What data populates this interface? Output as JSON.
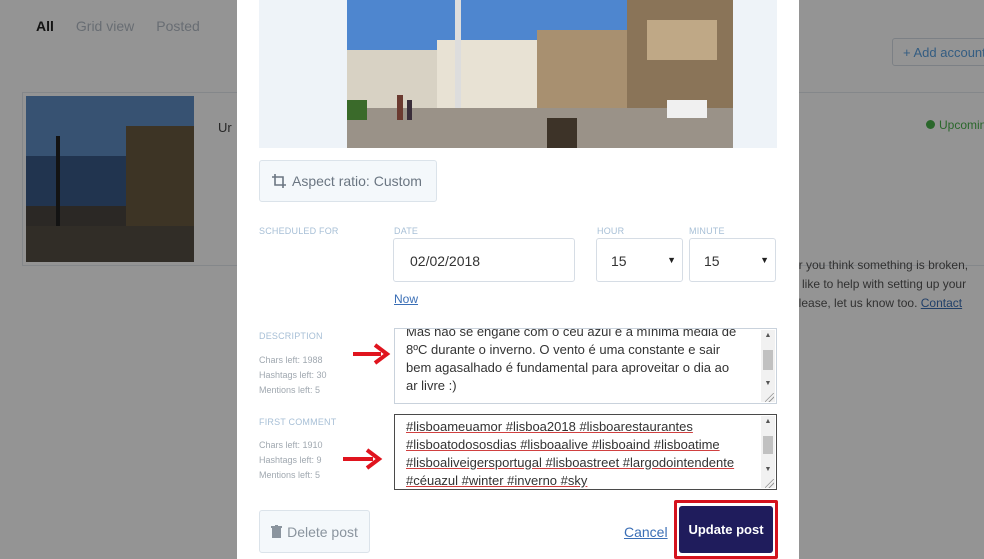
{
  "background": {
    "tabs": [
      "All",
      "Grid view",
      "Posted"
    ],
    "add_account": "+ Add account",
    "card_title": "Ur",
    "status": "Upcoming",
    "help_lines": [
      "or you think something is broken,",
      "d like to help with setting up your",
      "please, let us know too."
    ],
    "help_link": "Contact"
  },
  "modal": {
    "aspect_ratio": {
      "prefix": "Aspect ratio:",
      "value": "Custom"
    },
    "schedule": {
      "label": "SCHEDULED FOR",
      "date_label": "DATE",
      "date_value": "02/02/2018",
      "hour_label": "HOUR",
      "hour_value": "15",
      "minute_label": "MINUTE",
      "minute_value": "15",
      "now_link": "Now"
    },
    "description": {
      "label": "DESCRIPTION",
      "chars_left": "Chars left: 1988",
      "hashtags_left": "Hashtags left: 30",
      "mentions_left": "Mentions left: 5",
      "lines": [
        "Mas não se engane com o céu azul e a mínima média de",
        "8ºC durante o inverno. O vento é uma constante e sair",
        "bem agasalhado é fundamental para aproveitar o dia ao",
        "ar livre :)"
      ]
    },
    "first_comment": {
      "label": "FIRST COMMENT",
      "chars_left": "Chars left: 1910",
      "hashtags_left": "Hashtags left: 9",
      "mentions_left": "Mentions left: 5",
      "lines": [
        "#lisboameuamor #lisboa2018 #lisboarestaurantes",
        "#lisboatodososdias #lisboaalive #lisboaind #lisboatime",
        "#lisboaliveigersportugal #lisboastreet #largodointendente",
        "#céuazul #winter #inverno #sky"
      ]
    },
    "buttons": {
      "delete": "Delete post",
      "cancel": "Cancel",
      "update": "Update post"
    }
  }
}
